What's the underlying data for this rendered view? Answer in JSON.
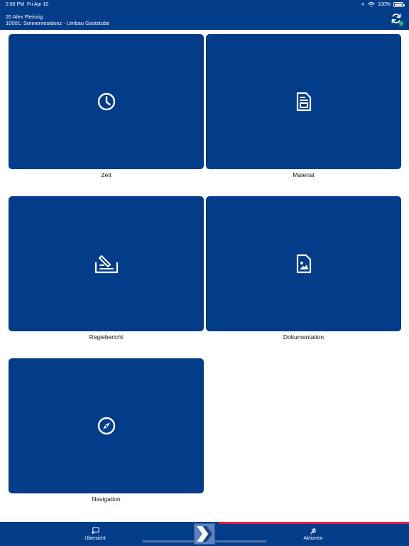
{
  "status": {
    "time": "2:56 PM",
    "date": "Fri Apr 10",
    "battery": "100%"
  },
  "header": {
    "user": "20 Alex Fleissig",
    "project": "10001: Sonnenresidenz - Umbau Gaststube",
    "sync_status": "online"
  },
  "tiles": [
    {
      "label": "Zeit",
      "icon": "clock-icon"
    },
    {
      "label": "Material",
      "icon": "document-icon"
    },
    {
      "label": "Regiebericht",
      "icon": "signature-icon"
    },
    {
      "label": "Dokumentation",
      "icon": "image-file-icon"
    },
    {
      "label": "Navigation",
      "icon": "compass-icon"
    }
  ],
  "tabbar": {
    "overview_label": "Übersicht",
    "actions_label": "Aktionen"
  },
  "colors": {
    "brand_blue": "#033d8a",
    "accent_red": "#d81f45",
    "online_green": "#21c45b"
  }
}
